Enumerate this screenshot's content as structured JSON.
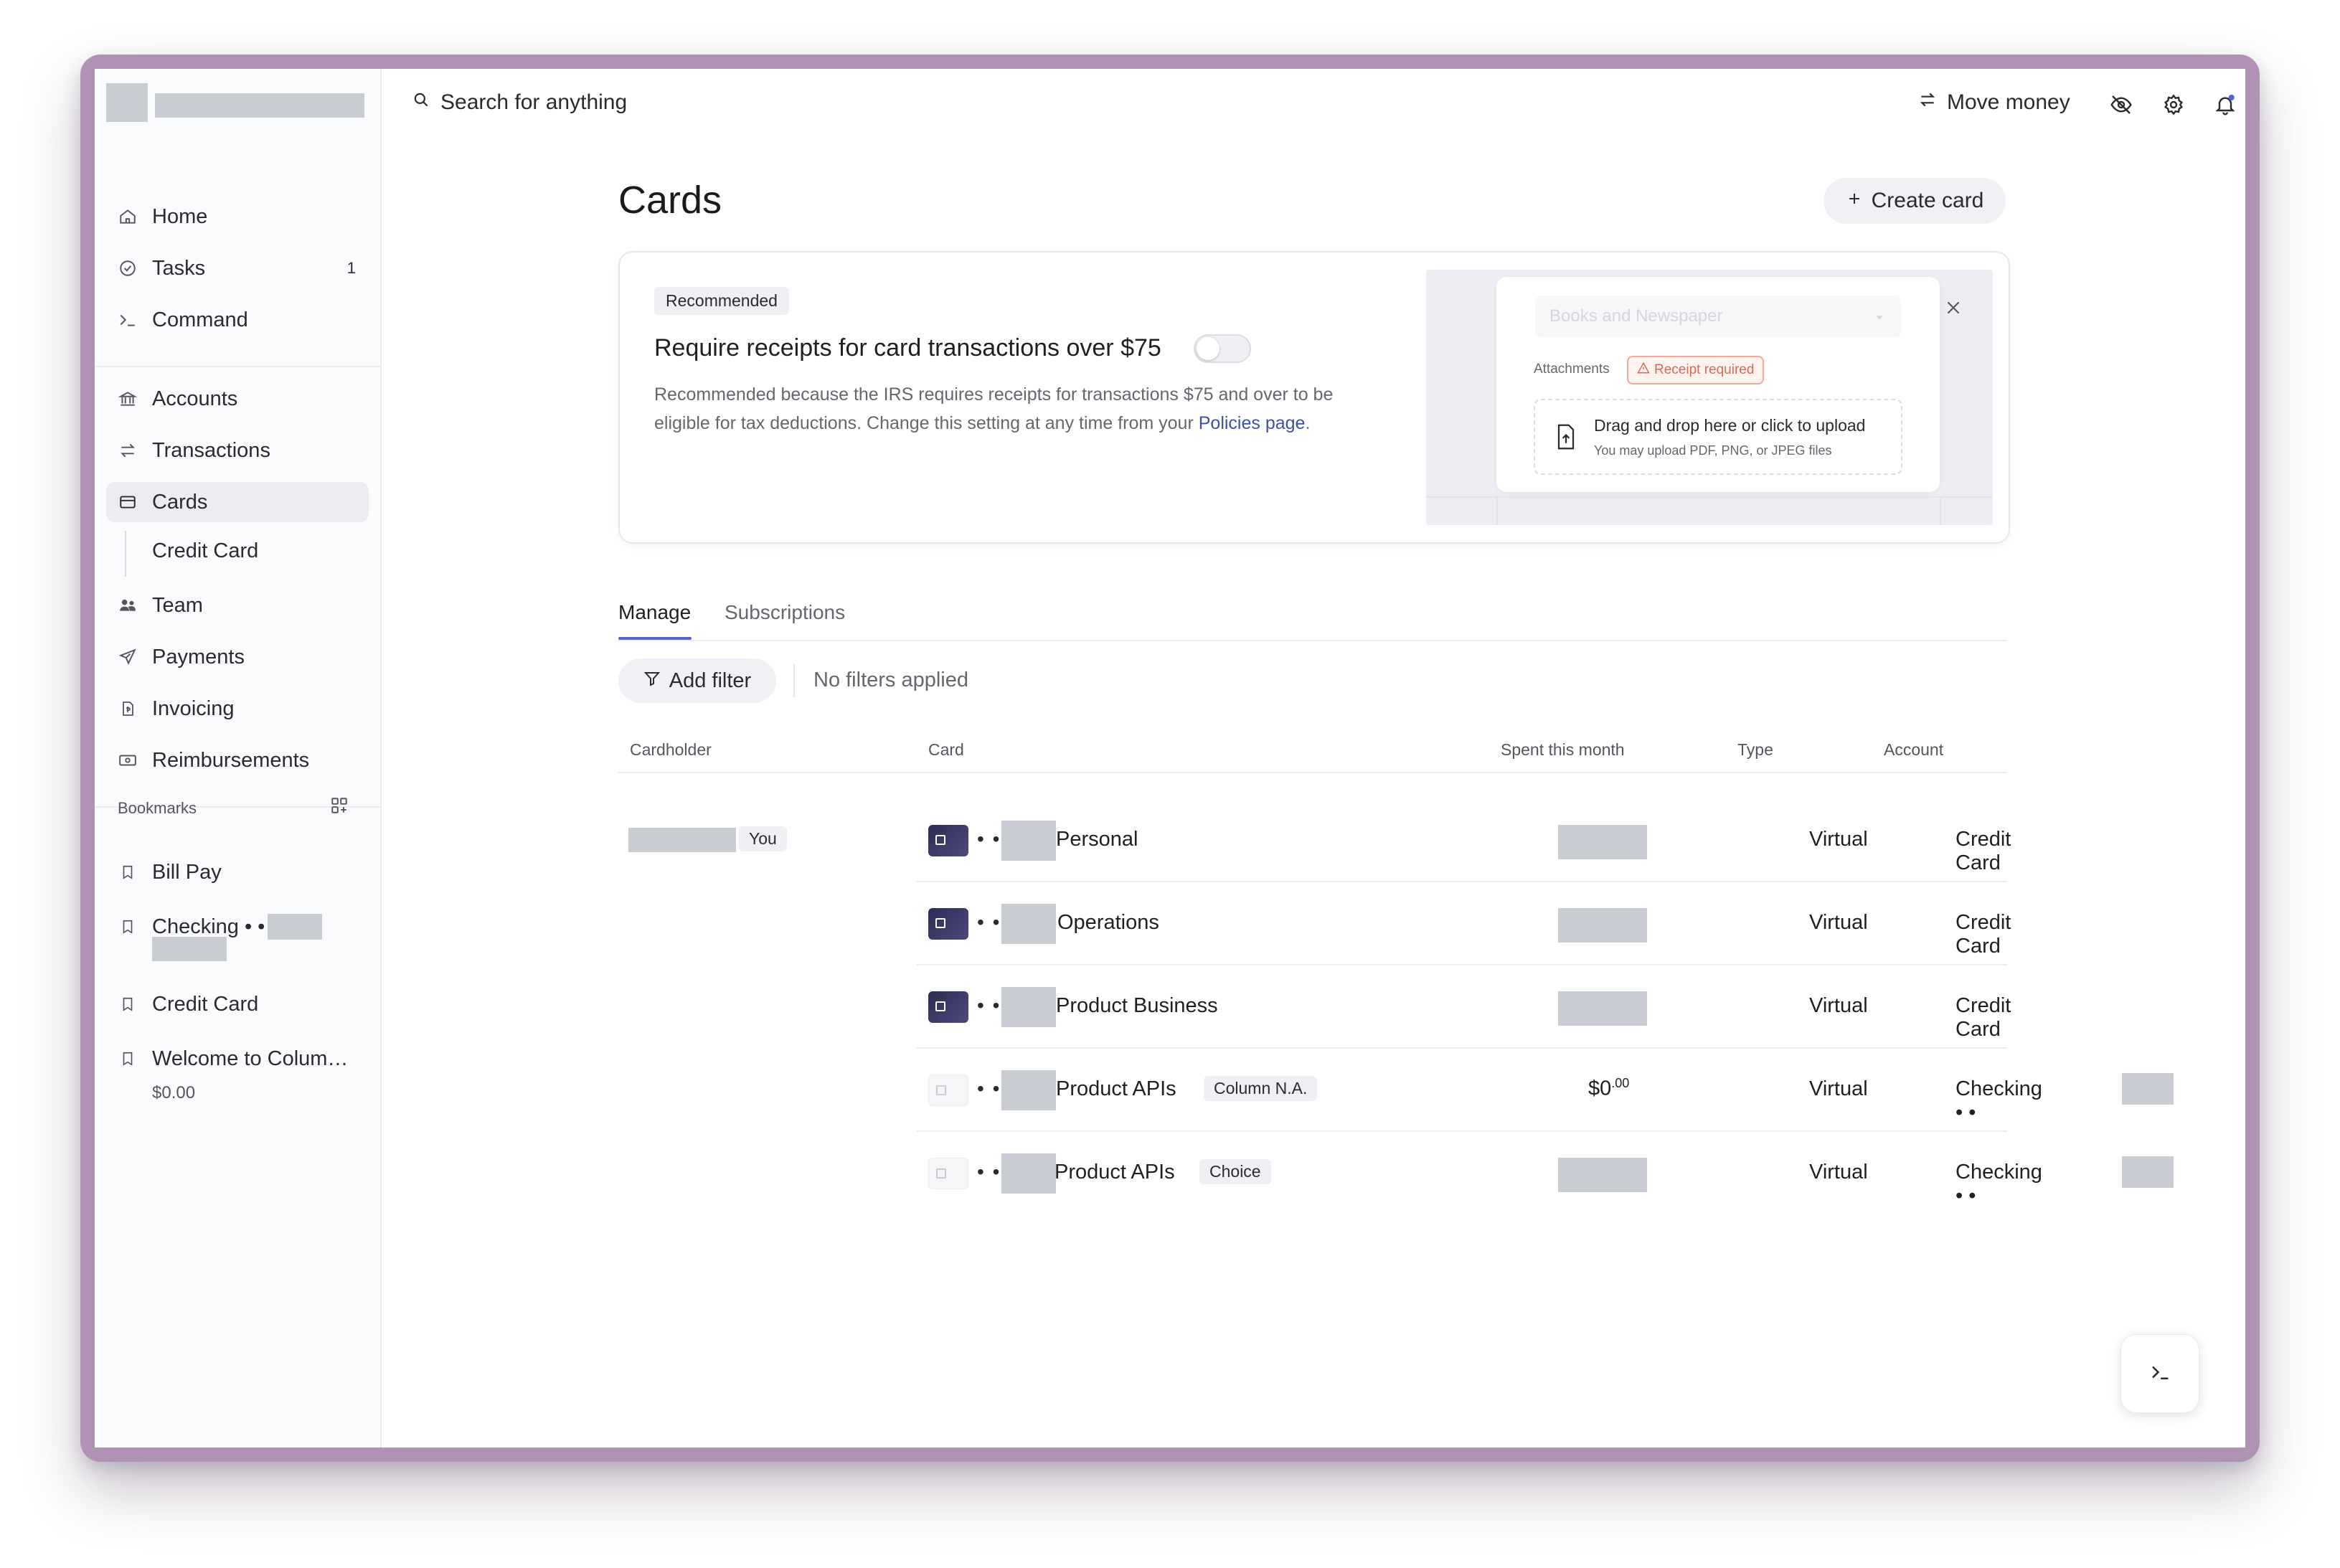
{
  "sidebar": {
    "nav": [
      {
        "label": "Home",
        "icon": "home-icon"
      },
      {
        "label": "Tasks",
        "icon": "check-circle-icon",
        "count": "1"
      },
      {
        "label": "Command",
        "icon": "terminal-icon"
      },
      {
        "label": "Accounts",
        "icon": "bank-icon"
      },
      {
        "label": "Transactions",
        "icon": "arrows-swap-icon"
      },
      {
        "label": "Cards",
        "icon": "credit-card-icon"
      },
      {
        "label": "Credit Card"
      },
      {
        "label": "Team",
        "icon": "team-icon"
      },
      {
        "label": "Payments",
        "icon": "paper-plane-icon"
      },
      {
        "label": "Invoicing",
        "icon": "invoice-icon"
      },
      {
        "label": "Reimbursements",
        "icon": "cash-icon"
      }
    ],
    "bookmarks_title": "Bookmarks",
    "bookmarks": [
      {
        "label": "Bill Pay"
      },
      {
        "label": "Checking • •"
      },
      {
        "label": "Credit Card"
      },
      {
        "label": "Welcome to Colum…",
        "sub": "$0.00"
      }
    ]
  },
  "topbar": {
    "search_placeholder": "Search for anything",
    "move_money": "Move money"
  },
  "page": {
    "title": "Cards",
    "create_button": "Create card"
  },
  "recommendation": {
    "badge": "Recommended",
    "title": "Require receipts for card transactions over $75",
    "toggle_on": false,
    "description": "Recommended because the IRS requires receipts for transactions $75 and over to be eligible for tax deductions. Change this setting at any time from your ",
    "link": "Policies page",
    "description_end": ".",
    "preview": {
      "dropdown": "Books and Newspaper",
      "attachments_label": "Attachments",
      "receipt_required": "Receipt required",
      "drop_title": "Drag and drop here or click to upload",
      "drop_sub": "You may upload PDF, PNG, or JPEG files"
    }
  },
  "tabs": [
    {
      "label": "Manage",
      "active": true
    },
    {
      "label": "Subscriptions",
      "active": false
    }
  ],
  "filters": {
    "add_filter": "Add filter",
    "status": "No filters applied"
  },
  "table": {
    "headers": {
      "cardholder": "Cardholder",
      "card": "Card",
      "spent": "Spent this month",
      "type": "Type",
      "account": "Account"
    },
    "you_badge": "You",
    "rows": [
      {
        "dots": "• •",
        "name": "Personal",
        "tag": "",
        "spent": "",
        "type": "Virtual",
        "account": "Credit Card",
        "style": "dark"
      },
      {
        "dots": "• •",
        "name": "Operations",
        "tag": "",
        "spent": "",
        "type": "Virtual",
        "account": "Credit Card",
        "style": "dark"
      },
      {
        "dots": "• •",
        "name": "Product Business",
        "tag": "",
        "spent": "",
        "type": "Virtual",
        "account": "Credit Card",
        "style": "dark"
      },
      {
        "dots": "• •",
        "name": "Product APIs",
        "tag": "Column N.A.",
        "spent": "$0",
        "spent_cents": ".00",
        "type": "Virtual",
        "account": "Checking • •",
        "style": "light"
      },
      {
        "dots": "• •",
        "name": "Product APIs",
        "tag": "Choice",
        "spent": "",
        "type": "Virtual",
        "account": "Checking • •",
        "style": "light"
      }
    ]
  },
  "colors": {
    "accent": "#5a63c7",
    "link": "#3e4fb3",
    "frame": "#b093b4",
    "card_dark": "#2e2c55"
  }
}
